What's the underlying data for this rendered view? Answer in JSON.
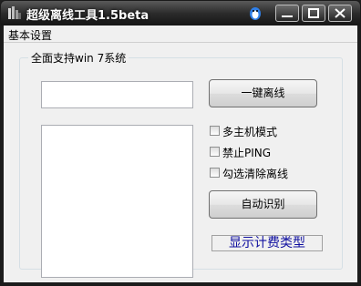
{
  "window": {
    "title": "超级离线工具1.5beta"
  },
  "menu": {
    "basic_settings": "基本设置"
  },
  "group": {
    "label": "全面支持win 7系统"
  },
  "buttons": {
    "one_key_offline": "一键离线",
    "auto_detect": "自动识别"
  },
  "checkboxes": [
    {
      "label": "多主机模式",
      "checked": false
    },
    {
      "label": "禁止PING",
      "checked": false
    },
    {
      "label": "勾选清除离线",
      "checked": false
    }
  ],
  "billing_type": "显示计费类型",
  "inputs": {
    "target_value": ""
  },
  "colors": {
    "titlebar": "#2c2c2c",
    "client": "#f0f0f0",
    "link_text": "#1010a0"
  }
}
